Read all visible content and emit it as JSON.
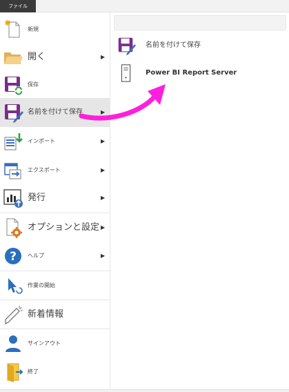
{
  "file_tab": "ファイル",
  "menu": [
    {
      "label": "新規",
      "size": "s",
      "icon": "new-file-icon",
      "chev": false
    },
    {
      "label": "開く",
      "size": "l",
      "icon": "folder-open-icon",
      "chev": true
    },
    {
      "label": "保存",
      "size": "s",
      "icon": "save-icon",
      "chev": false
    },
    {
      "label": "名前を付けて保存",
      "size": "m",
      "icon": "save-as-icon",
      "chev": true,
      "selected": true
    },
    {
      "label": "インポート",
      "size": "s",
      "icon": "import-icon",
      "chev": true
    },
    {
      "label": "エクスポート",
      "size": "s",
      "icon": "export-icon",
      "chev": true
    },
    {
      "label": "発行",
      "size": "l",
      "icon": "publish-icon",
      "chev": true
    },
    {
      "label": "オプションと設定",
      "size": "l",
      "icon": "options-icon",
      "chev": true
    },
    {
      "label": "ヘルプ",
      "size": "s",
      "icon": "help-icon",
      "chev": true
    },
    {
      "label": "作業の開始",
      "size": "s",
      "icon": "get-started-icon",
      "chev": false
    },
    {
      "label": "新着情報",
      "size": "l",
      "icon": "whats-new-icon",
      "chev": false
    },
    {
      "label": "サインアウト",
      "size": "s",
      "icon": "sign-out-icon",
      "chev": false
    },
    {
      "label": "終了",
      "size": "s",
      "icon": "exit-icon",
      "chev": false
    }
  ],
  "panel": {
    "items": [
      {
        "label": "名前を付けて保存",
        "icon": "save-as-icon"
      },
      {
        "label": "Power BI Report Server",
        "icon": "server-icon"
      }
    ]
  },
  "colors": {
    "accent_arrow": "#ff1fdc",
    "selected_bg": "#e6e6e6",
    "file_tab_bg": "#3a3a3a"
  }
}
